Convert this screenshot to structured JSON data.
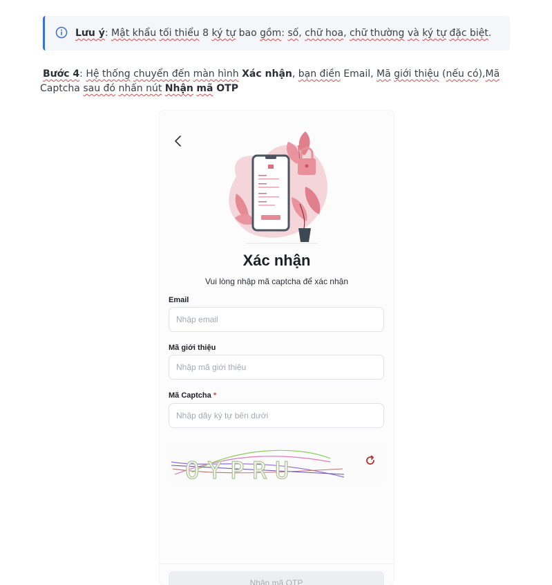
{
  "note": {
    "label": "Lưu ý",
    "colon": ": ",
    "w1": "Mật khẩu",
    "w2": "tối thiểu",
    "t1": " 8 ",
    "w3": "ký tự",
    "t2": " bao ",
    "w4": "gồm",
    "t3": ":  ",
    "w5": "số",
    "t4": ", ",
    "w6": "chữ hoa",
    "t5": ", ",
    "w7": "chữ thường",
    "t6": " ",
    "w8": "và",
    "t7": " ",
    "w9": "ký tự",
    "t8": " ",
    "w10": "đặc biệt",
    "t9": "."
  },
  "step": {
    "label": "Bước 4",
    "colon": ": ",
    "a1": "Hệ thống",
    "s1": " ",
    "a2": "chuyển đến",
    "s2": " ",
    "a3": "màn hình",
    "s3": " ",
    "b1": "Xác nhận",
    "s4": ", ",
    "a4": "bạn điền",
    "s5": " Email, ",
    "a5": "Mã",
    "s6": " ",
    "a6": "giới thiệu",
    "s7": " (",
    "a7": "nếu có",
    "s8": "),",
    "a8": "Mã",
    "s9": " Captcha ",
    "a9": "sau đó",
    "s10": " ",
    "a10": "nhấn nút",
    "s11": " ",
    "b2": "Nhận",
    "s12": " ",
    "b3": "mã",
    "b4": " OTP"
  },
  "screen": {
    "title": "Xác nhận",
    "subtitle": "Vui lòng nhập mã captcha để xác nhận",
    "email_label": "Email",
    "email_placeholder": "Nhập email",
    "ref_label": "Mã giới thiệu",
    "ref_placeholder": "Nhập mã giới thiệu",
    "captcha_label": "Mã Captcha",
    "captcha_required": "*",
    "captcha_placeholder": "Nhập dãy ký tự bên dưới",
    "captcha_image_text": "OYPRU",
    "button_label": "Nhận mã OTP"
  },
  "icons": {
    "info": "info-icon",
    "back": "chevron-left-icon",
    "refresh": "refresh-icon"
  },
  "colors": {
    "accent": "#3b6fd8",
    "illustration_pink": "#e9848f",
    "required": "#d93b3b",
    "refresh": "#b3322f"
  }
}
